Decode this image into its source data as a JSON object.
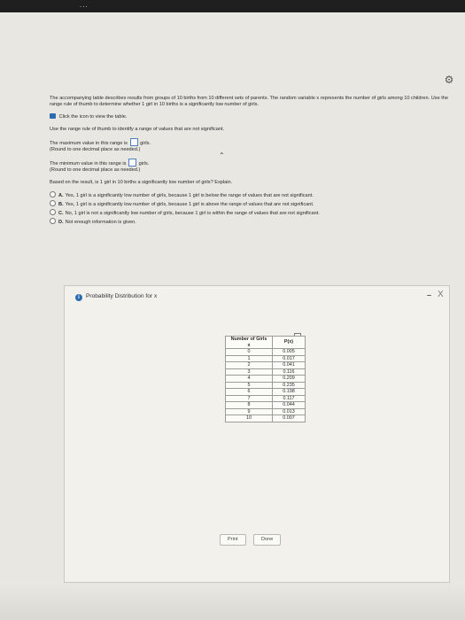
{
  "header": {
    "fragment": "..."
  },
  "question": {
    "intro": "The accompanying table describes results from groups of 10 births from 10 different sets of parents. The random variable x represents the number of girls among 10 children. Use the range rule of thumb to determine whether 1 girl in 10 births is a significantly low number of girls.",
    "view_table_link": "Click the icon to view the table.",
    "instruction": "Use the range rule of thumb to identify a range of values that are not significant.",
    "max_prefix": "The maximum value in this range is",
    "max_suffix": "girls.",
    "max_round": "(Round to one decimal place as needed.)",
    "min_prefix": "The minimum value in this range is",
    "min_suffix": "girls.",
    "min_round": "(Round to one decimal place as needed.)",
    "prompt": "Based on the result, is 1 girl in 10 births a significantly low number of girls? Explain.",
    "options": [
      {
        "letter": "A.",
        "text": "Yes, 1 girl is a significantly low number of girls, because 1 girl is below the range of values that are not significant."
      },
      {
        "letter": "B.",
        "text": "Yes, 1 girl is a significantly low number of girls, because 1 girl is above the range of values that are not significant."
      },
      {
        "letter": "C.",
        "text": "No, 1 girl is not a significantly low number of girls, because 1 girl is within the range of values that are not significant."
      },
      {
        "letter": "D.",
        "text": "Not enough information is given."
      }
    ]
  },
  "modal": {
    "title": "Probability Distribution for x",
    "minimize": "–",
    "close": "X",
    "table": {
      "headers": [
        "Number of Girls x",
        "P(x)"
      ],
      "rows": [
        [
          "0",
          "0.005"
        ],
        [
          "1",
          "0.017"
        ],
        [
          "2",
          "0.041"
        ],
        [
          "3",
          "0.116"
        ],
        [
          "4",
          "0.209"
        ],
        [
          "5",
          "0.235"
        ],
        [
          "6",
          "0.198"
        ],
        [
          "7",
          "0.117"
        ],
        [
          "8",
          "0.044"
        ],
        [
          "9",
          "0.013"
        ],
        [
          "10",
          "0.007"
        ]
      ]
    },
    "print_label": "Print",
    "done_label": "Done"
  }
}
